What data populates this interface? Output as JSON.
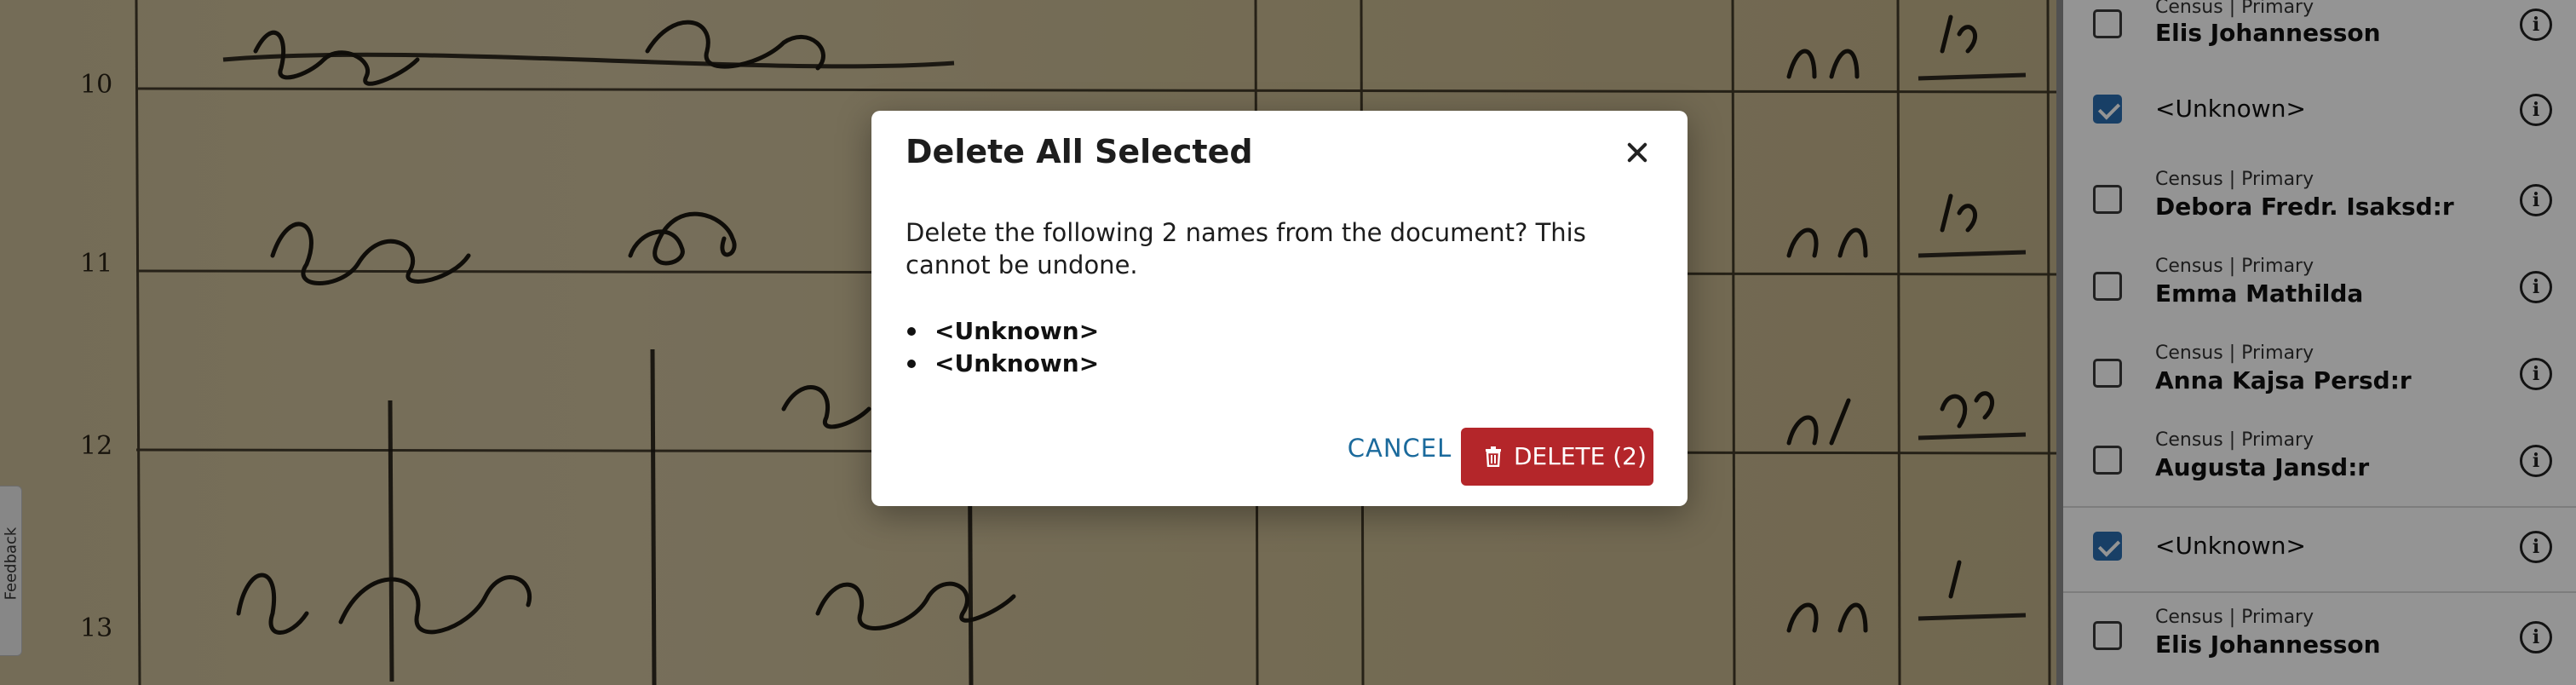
{
  "document": {
    "row_numbers": [
      "10",
      "11",
      "12",
      "13"
    ],
    "feedback_label": "Feedback"
  },
  "name_list": [
    {
      "meta": "Census | Primary",
      "name": "Elis Johannesson",
      "checked": false
    },
    {
      "meta": "",
      "name": "<Unknown>",
      "checked": true
    },
    {
      "meta": "Census | Primary",
      "name": "Debora Fredr. Isaksd:r",
      "checked": false
    },
    {
      "meta": "Census | Primary",
      "name": "Emma Mathilda",
      "checked": false
    },
    {
      "meta": "Census | Primary",
      "name": "Anna Kajsa Persd:r",
      "checked": false
    },
    {
      "meta": "Census | Primary",
      "name": "Augusta Jansd:r",
      "checked": false
    },
    {
      "meta": "",
      "name": "<Unknown>",
      "checked": true
    },
    {
      "meta": "Census | Primary",
      "name": "Elis Johannesson",
      "checked": false
    }
  ],
  "info_icon": "info-icon",
  "dialog": {
    "title": "Delete All Selected",
    "message": "Delete the following 2 names from the document? This cannot be undone.",
    "names": [
      "<Unknown>",
      "<Unknown>"
    ],
    "cancel_label": "CANCEL",
    "delete_label": "DELETE (2)",
    "accent_color": "#b4262a",
    "link_color": "#1b6a9c"
  }
}
